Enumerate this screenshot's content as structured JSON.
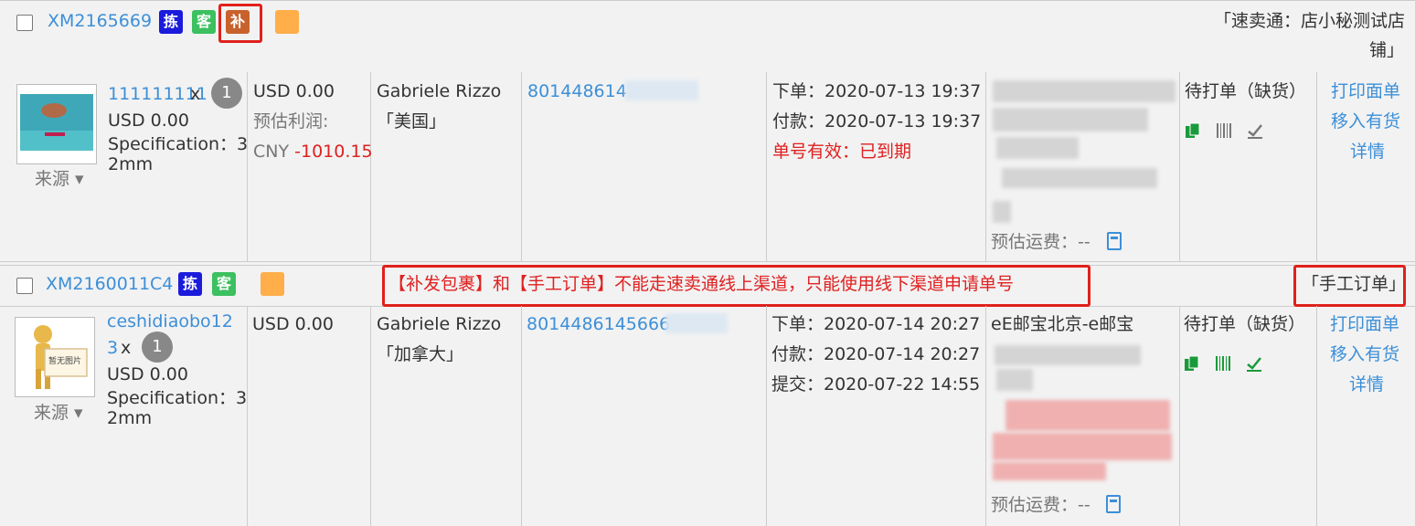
{
  "orders": [
    {
      "id": "XM2165669",
      "tags": [
        "拣",
        "客",
        "补"
      ],
      "store": "「速卖通：店小秘测试店",
      "store_cont": "铺」",
      "product": {
        "sku": "111111111",
        "times": "x",
        "qty": "1",
        "price": "USD 0.00",
        "spec_label": "Specification：3",
        "spec_cont": "2mm",
        "source": "来源"
      },
      "amount": "USD 0.00",
      "profit_label": "预估利润:",
      "profit_currency": "CNY",
      "profit_value": "-1010.15",
      "buyer": "Gabriele Rizzo",
      "country": "「美国」",
      "tracking": "8014486145",
      "times": [
        "下单：2020-07-13 19:37",
        "付款：2020-07-13 19:37"
      ],
      "validity": "单号有效：已到期",
      "shipping_est": "预估运费：--",
      "status": "待打单（缺货）",
      "actions": [
        "打印面单",
        "移入有货",
        "详情"
      ]
    },
    {
      "id": "XM2160011C4",
      "tags": [
        "拣",
        "客"
      ],
      "store": "「手工订单」",
      "product": {
        "sku": "ceshidiaobo12",
        "sku_cont": "3",
        "times": "x",
        "qty": "1",
        "price": "USD 0.00",
        "spec_label": "Specification：3",
        "spec_cont": "2mm",
        "source": "来源",
        "no_image": "暂无图片"
      },
      "amount": "USD 0.00",
      "buyer": "Gabriele Rizzo",
      "country": "「加拿大」",
      "tracking": "80144861456663",
      "times": [
        "下单：2020-07-14 20:27",
        "付款：2020-07-14 20:27",
        "提交：2020-07-22 14:55"
      ],
      "channel": "eE邮宝北京-e邮宝",
      "shipping_est": "预估运费：--",
      "status": "待打单（缺货）",
      "actions": [
        "打印面单",
        "移入有货",
        "详情"
      ]
    }
  ],
  "notice": "【补发包裹】和【手工订单】不能走速卖通线上渠道，只能使用线下渠道申请单号",
  "colors": {
    "link": "#3c8fd8",
    "alert": "#e0201c",
    "tag_blue": "#1b1bdc",
    "tag_green": "#3cc060",
    "tag_brown": "#c8622c",
    "tag_orange": "#ffae4a"
  }
}
